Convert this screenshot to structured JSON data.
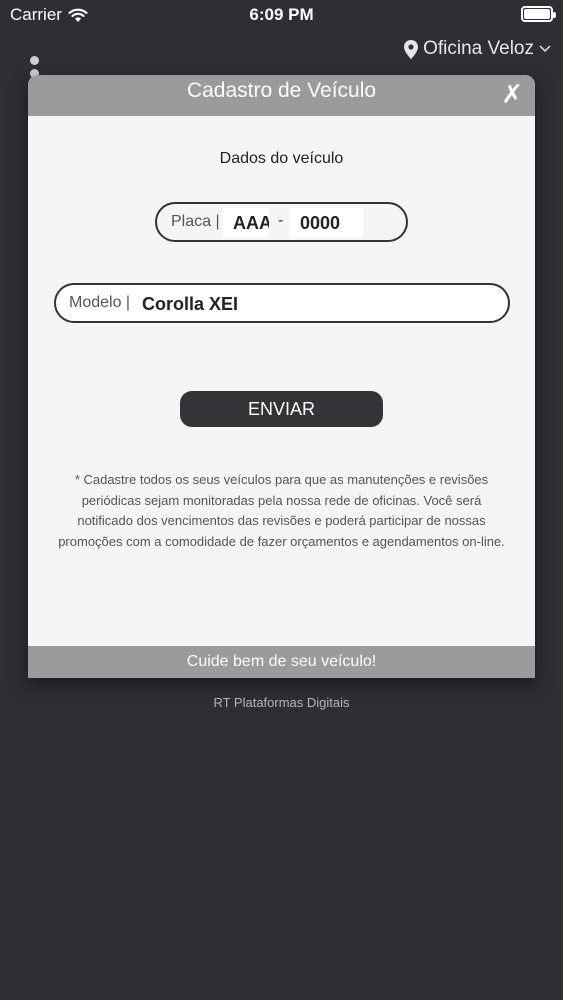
{
  "status_bar": {
    "carrier": "Carrier",
    "time": "6:09 PM"
  },
  "header": {
    "location": "Oficina Veloz"
  },
  "modal": {
    "title": "Cadastro de Veículo",
    "close_glyph": "✗",
    "section_title": "Dados do veículo",
    "plate": {
      "label": "Placa |",
      "letters_value": "AAA",
      "separator": "-",
      "numbers_value": "0000"
    },
    "model": {
      "label": "Modelo |",
      "value": "Corolla XEI"
    },
    "send_label": "ENVIAR",
    "info": "* Cadastre todos os seus veículos para que as manutenções e revisões periódicas sejam monitoradas pela nossa rede de oficinas. Você será notificado dos vencimentos das revisões e poderá participar de nossas promoções com a comodidade de fazer orçamentos e agendamentos on-line.",
    "footer": "Cuide bem de seu veículo!"
  },
  "credits": "RT Plataformas Digitais"
}
